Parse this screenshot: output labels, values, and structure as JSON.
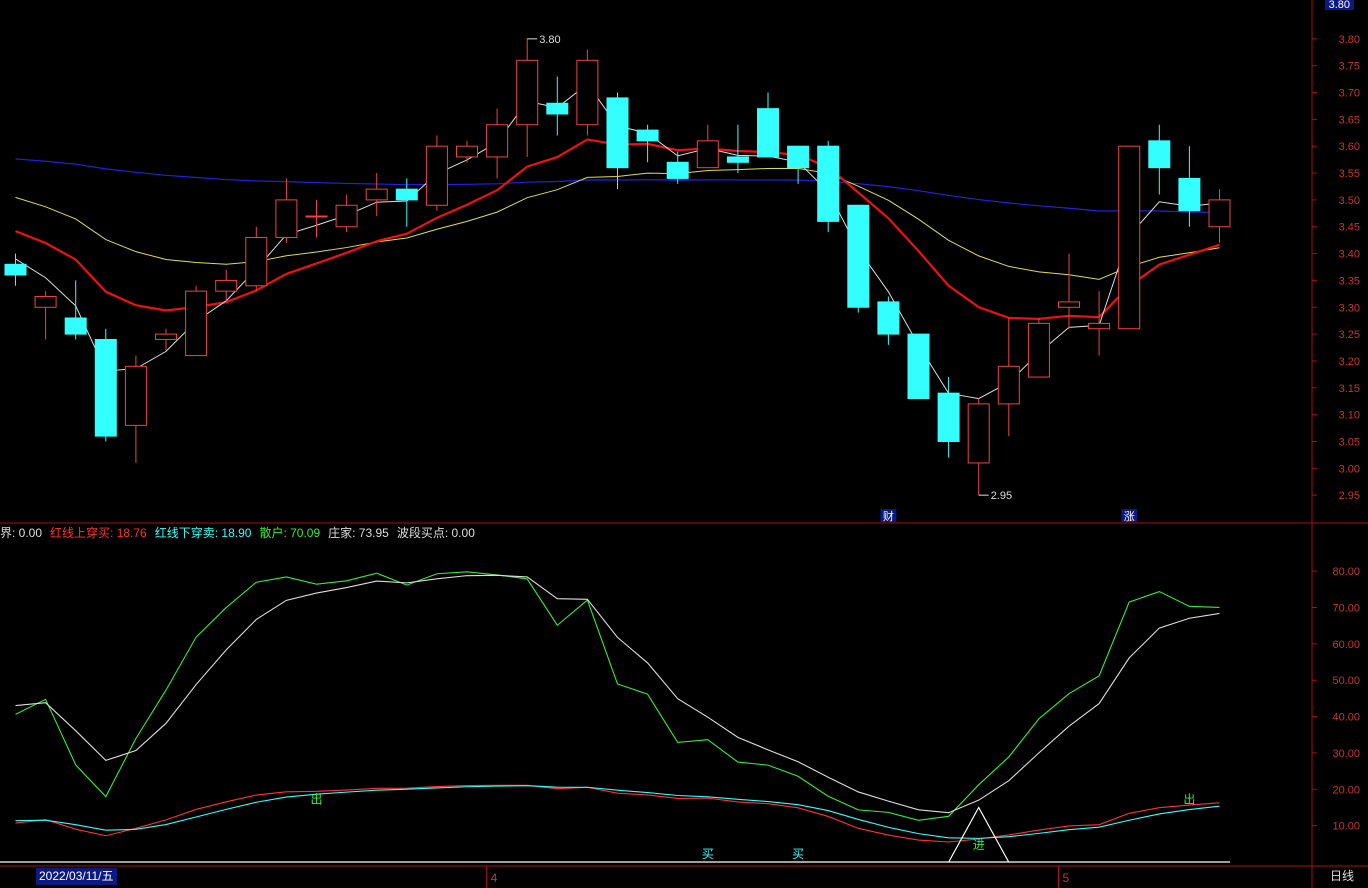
{
  "chart_data": [
    {
      "type": "candlestick",
      "ylim": [
        2.9,
        3.85
      ],
      "ticks": [
        2.95,
        3.0,
        3.05,
        3.1,
        3.15,
        3.2,
        3.25,
        3.3,
        3.35,
        3.4,
        3.45,
        3.5,
        3.55,
        3.6,
        3.65,
        3.7,
        3.75,
        3.8
      ],
      "last_price": "3.80",
      "high_label": "3.80",
      "low_label": "2.95",
      "markers": [
        {
          "label": "财",
          "index": 29
        },
        {
          "label": "涨",
          "index": 37
        }
      ],
      "candles": [
        [
          3.38,
          3.4,
          3.34,
          3.36
        ],
        [
          3.3,
          3.33,
          3.24,
          3.32
        ],
        [
          3.28,
          3.35,
          3.24,
          3.25
        ],
        [
          3.24,
          3.26,
          3.05,
          3.06
        ],
        [
          3.08,
          3.21,
          3.01,
          3.19
        ],
        [
          3.24,
          3.26,
          3.22,
          3.25
        ],
        [
          3.21,
          3.34,
          3.21,
          3.33
        ],
        [
          3.33,
          3.37,
          3.31,
          3.35
        ],
        [
          3.34,
          3.45,
          3.33,
          3.43
        ],
        [
          3.43,
          3.54,
          3.42,
          3.5
        ],
        [
          3.47,
          3.5,
          3.43,
          3.47
        ],
        [
          3.45,
          3.51,
          3.44,
          3.49
        ],
        [
          3.5,
          3.55,
          3.47,
          3.52
        ],
        [
          3.52,
          3.54,
          3.45,
          3.5
        ],
        [
          3.49,
          3.62,
          3.48,
          3.6
        ],
        [
          3.58,
          3.61,
          3.57,
          3.6
        ],
        [
          3.58,
          3.67,
          3.54,
          3.64
        ],
        [
          3.64,
          3.8,
          3.58,
          3.76
        ],
        [
          3.68,
          3.73,
          3.62,
          3.66
        ],
        [
          3.64,
          3.78,
          3.62,
          3.76
        ],
        [
          3.69,
          3.7,
          3.52,
          3.56
        ],
        [
          3.63,
          3.64,
          3.57,
          3.61
        ],
        [
          3.57,
          3.59,
          3.53,
          3.54
        ],
        [
          3.56,
          3.64,
          3.56,
          3.61
        ],
        [
          3.58,
          3.64,
          3.55,
          3.57
        ],
        [
          3.67,
          3.7,
          3.58,
          3.58
        ],
        [
          3.6,
          3.6,
          3.53,
          3.56
        ],
        [
          3.6,
          3.61,
          3.44,
          3.46
        ],
        [
          3.49,
          3.49,
          3.29,
          3.3
        ],
        [
          3.31,
          3.32,
          3.23,
          3.25
        ],
        [
          3.25,
          3.25,
          3.13,
          3.13
        ],
        [
          3.14,
          3.17,
          3.02,
          3.05
        ],
        [
          3.01,
          3.13,
          2.95,
          3.12
        ],
        [
          3.12,
          3.28,
          3.06,
          3.19
        ],
        [
          3.17,
          3.28,
          3.17,
          3.27
        ],
        [
          3.3,
          3.4,
          3.26,
          3.31
        ],
        [
          3.26,
          3.33,
          3.21,
          3.27
        ],
        [
          3.26,
          3.6,
          3.26,
          3.6
        ],
        [
          3.61,
          3.64,
          3.51,
          3.56
        ],
        [
          3.54,
          3.6,
          3.45,
          3.48
        ],
        [
          3.45,
          3.52,
          3.42,
          3.5
        ]
      ]
    },
    {
      "type": "line",
      "ylim": [
        0,
        88
      ],
      "ticks": [
        10.0,
        20.0,
        30.0,
        40.0,
        50.0,
        60.0,
        70.0,
        80.0
      ],
      "legend": [
        {
          "label": "界: 0.00",
          "color": "#dddddd"
        },
        {
          "label": "红线上穿买: 18.76",
          "color": "#ff3333"
        },
        {
          "label": "红线下穿卖: 18.90",
          "color": "#33ffff"
        },
        {
          "label": "散户: 70.09",
          "color": "#33ee33"
        },
        {
          "label": "庄家: 73.95",
          "color": "#dddddd"
        },
        {
          "label": "波段买点: 0.00",
          "color": "#dddddd"
        }
      ],
      "markers": [
        {
          "label": "出",
          "index": 10,
          "value": 17.5,
          "color": "#33ee33"
        },
        {
          "label": "买",
          "index": 23,
          "value": 2.5,
          "color": "#33ffff"
        },
        {
          "label": "买",
          "index": 26,
          "value": 2.5,
          "color": "#33ffff"
        },
        {
          "label": "进",
          "index": 32,
          "value": 5,
          "color": "#33ee33"
        },
        {
          "label": "出",
          "index": 39,
          "value": 17.5,
          "color": "#33ee33"
        }
      ],
      "date_label": "2022/03/11/五",
      "month_labels": [
        {
          "label": "4",
          "index": 16
        },
        {
          "label": "5",
          "index": 35
        }
      ],
      "period": "日线"
    }
  ]
}
